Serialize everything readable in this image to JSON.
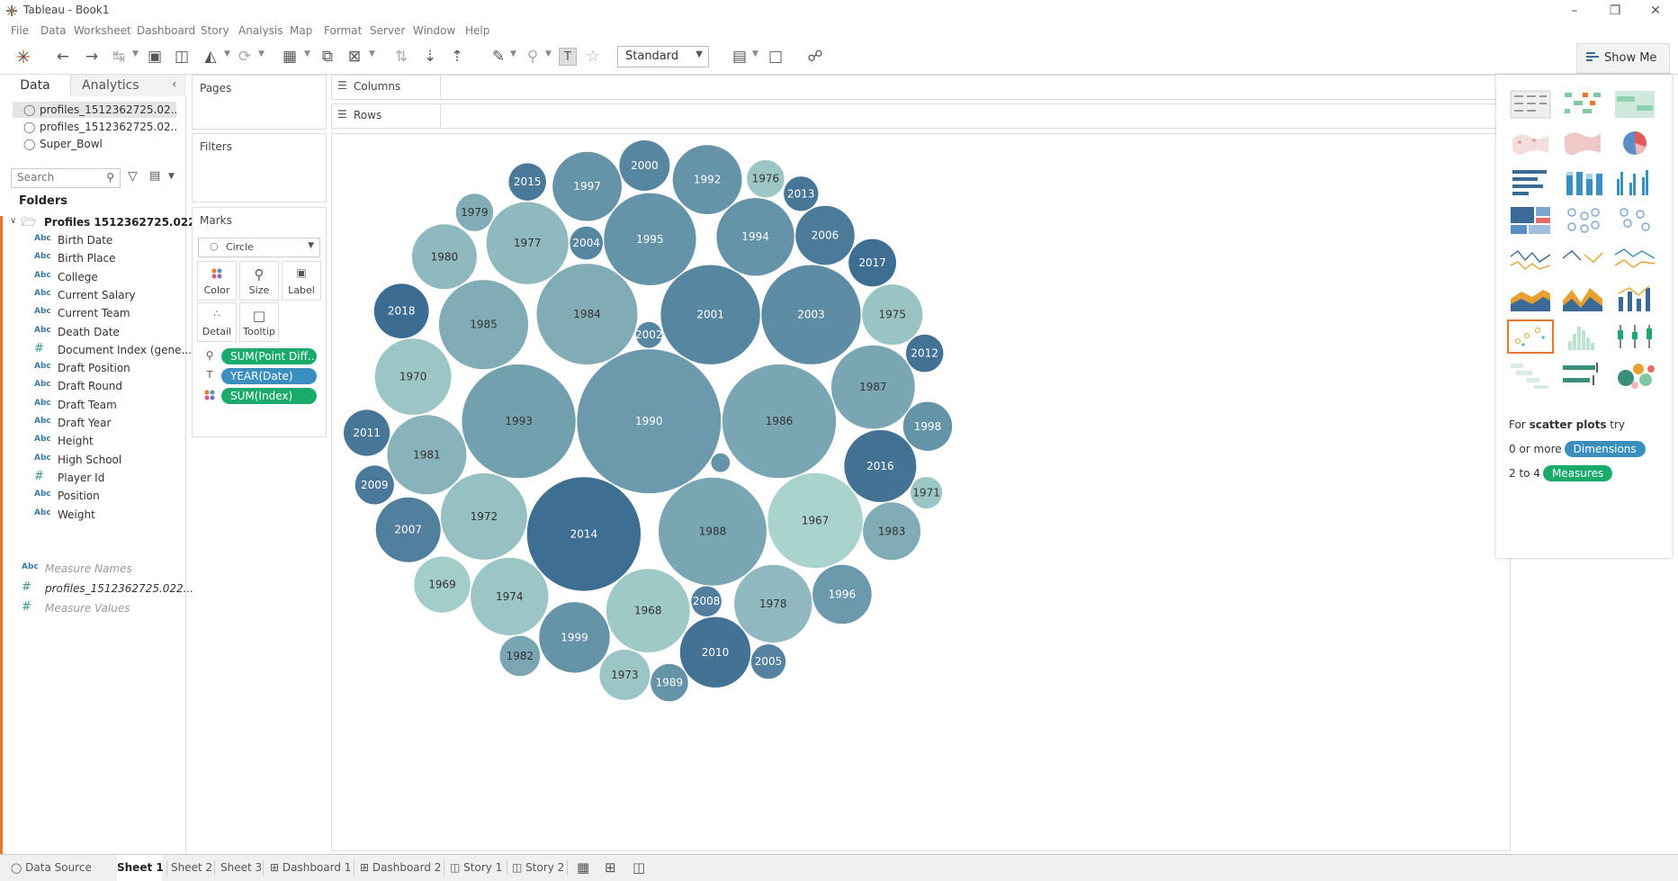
{
  "window": {
    "title": "Tableau - Book1"
  },
  "menu": [
    "File",
    "Data",
    "Worksheet",
    "Dashboard",
    "Story",
    "Analysis",
    "Map",
    "Format",
    "Server",
    "Window",
    "Help"
  ],
  "toolbar": {
    "fit_select": "Standard",
    "show_me": "Show Me"
  },
  "data_pane": {
    "tabs": [
      "Data",
      "Analytics"
    ],
    "datasources": [
      "profiles_1512362725.02...",
      "profiles_1512362725.02...",
      "Super_Bowl"
    ],
    "search_placeholder": "Search",
    "folders_label": "Folders",
    "folder_name": "Profiles 1512362725.022...",
    "fields": [
      {
        "type": "Abc",
        "name": "Birth Date"
      },
      {
        "type": "Abc",
        "name": "Birth Place"
      },
      {
        "type": "Abc",
        "name": "College"
      },
      {
        "type": "Abc",
        "name": "Current Salary"
      },
      {
        "type": "Abc",
        "name": "Current Team"
      },
      {
        "type": "Abc",
        "name": "Death Date"
      },
      {
        "type": "#",
        "name": "Document Index (gene..."
      },
      {
        "type": "Abc",
        "name": "Draft Position"
      },
      {
        "type": "Abc",
        "name": "Draft Round"
      },
      {
        "type": "Abc",
        "name": "Draft Team"
      },
      {
        "type": "Abc",
        "name": "Draft Year"
      },
      {
        "type": "Abc",
        "name": "Height"
      },
      {
        "type": "Abc",
        "name": "High School"
      },
      {
        "type": "#",
        "name": "Player Id"
      },
      {
        "type": "Abc",
        "name": "Position"
      },
      {
        "type": "Abc",
        "name": "Weight"
      }
    ],
    "measure_fields": [
      {
        "type": "Abc",
        "name": "Measure Names"
      },
      {
        "type": "#",
        "name": "profiles_1512362725.022..."
      },
      {
        "type": "#",
        "name": "Measure Values"
      }
    ]
  },
  "cards": {
    "pages": "Pages",
    "filters": "Filters",
    "marks": "Marks",
    "mark_type": "Circle",
    "buttons": [
      "Color",
      "Size",
      "Label",
      "Detail",
      "Tooltip"
    ],
    "pills": [
      {
        "text": "SUM(Point Diff..",
        "color": "#1aaa6b"
      },
      {
        "text": "YEAR(Date)",
        "color": "#3b8fbf"
      },
      {
        "text": "SUM(Index)",
        "color": "#1aaa6b"
      }
    ]
  },
  "shelves": {
    "columns": "Columns",
    "rows": "Rows"
  },
  "chart_data": {
    "type": "packed-bubble",
    "bubbles": [
      {
        "label": "1990",
        "size": 1.0,
        "shade": 0.55
      },
      {
        "label": "1999",
        "size": 0.49,
        "shade": 0.6
      },
      {
        "label": "2002",
        "size": 0.18,
        "shade": 0.7
      },
      {
        "label": "2006",
        "size": 0.41,
        "shade": 0.78
      },
      {
        "label": "1998",
        "size": 0.34,
        "shade": 0.6
      },
      {
        "label": "2007",
        "size": 0.45,
        "shade": 0.75
      },
      {
        "label": "2008",
        "size": 0.21,
        "shade": 0.75
      },
      {
        "label": "2010",
        "size": 0.49,
        "shade": 0.85
      },
      {
        "label": "1997",
        "size": 0.48,
        "shade": 0.6
      },
      {
        "label": "1989",
        "size": 0.26,
        "shade": 0.6
      },
      {
        "label": "1982",
        "size": 0.28,
        "shade": 0.45
      },
      {
        "label": "1983",
        "size": 0.4,
        "shade": 0.4
      },
      {
        "label": "1984",
        "size": 0.7,
        "shade": 0.4
      },
      {
        "label": "1994",
        "size": 0.54,
        "shade": 0.6
      },
      {
        "label": "1979",
        "size": 0.26,
        "shade": 0.4
      },
      {
        "label": "2009",
        "size": 0.27,
        "shade": 0.8
      },
      {
        "label": "1978",
        "size": 0.54,
        "shade": 0.3
      },
      {
        "label": "1970",
        "size": 0.53,
        "shade": 0.2
      },
      {
        "label": "1971",
        "size": 0.22,
        "shade": 0.2
      },
      {
        "label": "1972",
        "size": 0.6,
        "shade": 0.25
      },
      {
        "label": "1995",
        "size": 0.64,
        "shade": 0.6
      },
      {
        "label": "1996",
        "size": 0.41,
        "shade": 0.55
      },
      {
        "label": "2001",
        "size": 0.69,
        "shade": 0.7
      },
      {
        "label": "1977",
        "size": 0.57,
        "shade": 0.3
      },
      {
        "label": "1967",
        "size": 0.66,
        "shade": 0.1
      },
      {
        "label": "1968",
        "size": 0.58,
        "shade": 0.18
      },
      {
        "label": "1992",
        "size": 0.48,
        "shade": 0.6
      },
      {
        "label": "1973",
        "size": 0.35,
        "shade": 0.2
      },
      {
        "label": "2015",
        "size": 0.26,
        "shade": 0.8
      },
      {
        "label": "2000",
        "size": 0.35,
        "shade": 0.7
      },
      {
        "label": "1976",
        "size": 0.26,
        "shade": 0.2
      },
      {
        "label": "1969",
        "size": 0.39,
        "shade": 0.15
      },
      {
        "label": "1974",
        "size": 0.54,
        "shade": 0.2
      },
      {
        "label": "1986",
        "size": 0.79,
        "shade": 0.45
      },
      {
        "label": "2016",
        "size": 0.5,
        "shade": 0.85
      },
      {
        "label": "2004",
        "size": 0.23,
        "shade": 0.7
      },
      {
        "label": "1985",
        "size": 0.62,
        "shade": 0.4
      },
      {
        "label": "1975",
        "size": 0.42,
        "shade": 0.22
      },
      {
        "label": "1980",
        "size": 0.45,
        "shade": 0.3
      },
      {
        "label": "2005",
        "size": 0.24,
        "shade": 0.72
      },
      {
        "label": "1981",
        "size": 0.55,
        "shade": 0.35
      },
      {
        "label": "2017",
        "size": 0.33,
        "shade": 0.88
      },
      {
        "label": "1987",
        "size": 0.58,
        "shade": 0.45
      },
      {
        "label": "2011",
        "size": 0.32,
        "shade": 0.82
      },
      {
        "label": "2018",
        "size": 0.38,
        "shade": 0.9
      },
      {
        "label": "2003",
        "size": 0.69,
        "shade": 0.65
      },
      {
        "label": "1988",
        "size": 0.75,
        "shade": 0.45
      },
      {
        "label": "2012",
        "size": 0.26,
        "shade": 0.85
      },
      {
        "label": "2013",
        "size": 0.24,
        "shade": 0.82
      },
      {
        "label": "1993",
        "size": 0.79,
        "shade": 0.5
      },
      {
        "label": "2014",
        "size": 0.79,
        "shade": 0.88
      },
      {
        "label": "",
        "size": 0.13,
        "shade": 0.6
      }
    ],
    "color_range": [
      "#b8e0d4",
      "#2e5f8a"
    ]
  },
  "show_me": {
    "hint_prefix": "For ",
    "hint_bold": "scatter plots",
    "hint_suffix": " try",
    "dimensions_prefix": "0 or more",
    "dimensions_label": "Dimensions",
    "dimensions_color": "#3b8fbf",
    "measures_prefix": "2 to 4",
    "measures_label": "Measures",
    "measures_color": "#1aaa6b"
  },
  "tabs": {
    "data_source": "Data Source",
    "sheets": [
      "Sheet 1",
      "Sheet 2",
      "Sheet 3",
      "Dashboard 1",
      "Dashboard 2",
      "Story 1",
      "Story 2"
    ]
  }
}
